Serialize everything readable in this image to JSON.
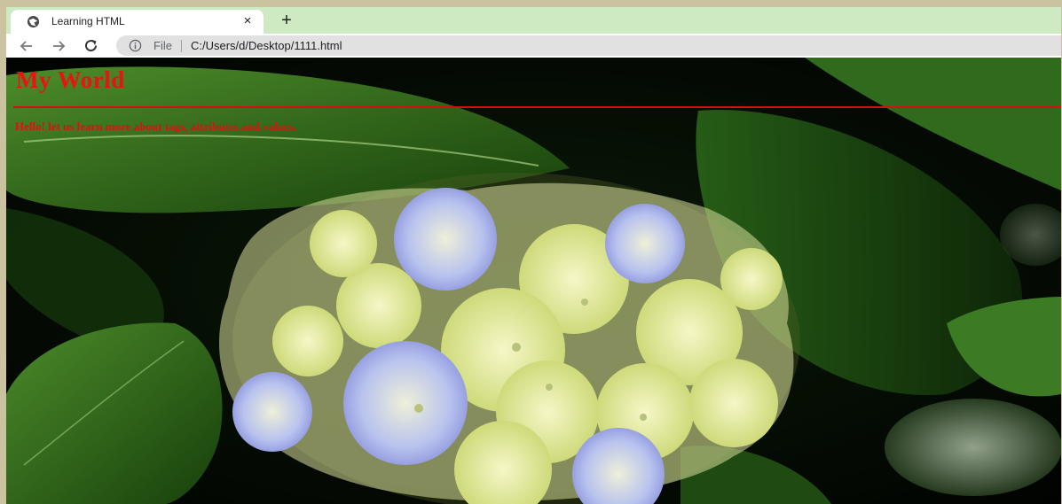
{
  "browser": {
    "tab": {
      "title": "Learning HTML",
      "close_glyph": "×"
    },
    "new_tab_glyph": "+",
    "address_bar": {
      "scheme_label": "File",
      "url": "C:/Users/d/Desktop/1111.html"
    },
    "icons": {
      "favicon": "globe-icon",
      "back": "arrow-left-icon",
      "forward": "arrow-right-icon",
      "reload": "reload-icon",
      "info": "info-icon"
    }
  },
  "page": {
    "heading": "My World",
    "paragraph": "Hello! let us learn more about tags, attributes and values.",
    "colors": {
      "heading": "#ee1111",
      "rule": "#d40f0f",
      "text": "#e01010"
    }
  },
  "colors": {
    "tabstrip": "#cdeac3",
    "frame": "#cbc3a0",
    "omnibox": "#e1e1e1"
  }
}
